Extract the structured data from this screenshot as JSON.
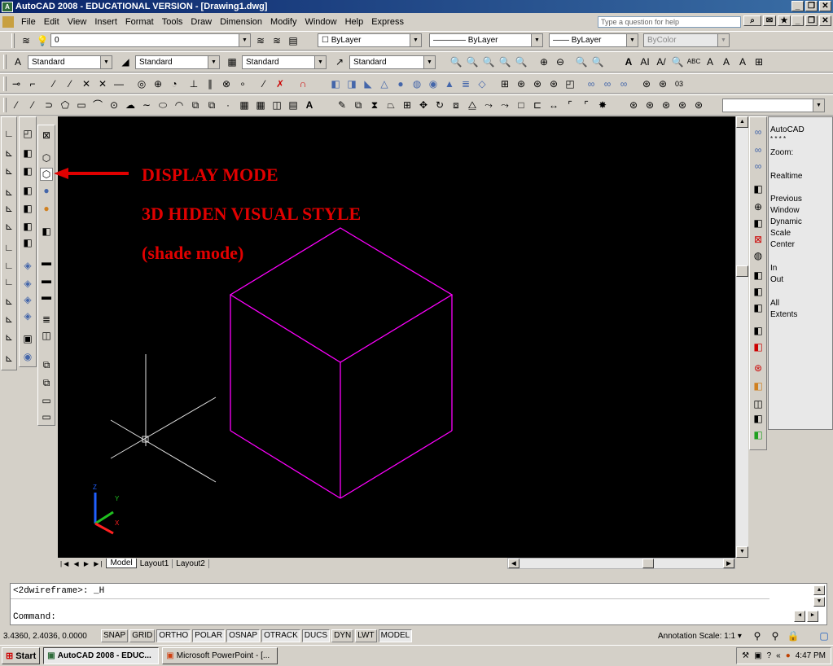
{
  "window": {
    "title": "AutoCAD 2008 - EDUCATIONAL VERSION - [Drawing1.dwg]"
  },
  "menu": [
    "File",
    "Edit",
    "View",
    "Insert",
    "Format",
    "Tools",
    "Draw",
    "Dimension",
    "Modify",
    "Window",
    "Help",
    "Express"
  ],
  "help": {
    "placeholder": "Type a question for help"
  },
  "layers": {
    "layer_value": "0",
    "color_value": "ByLayer",
    "linetype_value": "ByLayer",
    "lineweight_value": "ByLayer",
    "plotstyle_value": "ByColor"
  },
  "styles": {
    "text_style": "Standard",
    "dim_style": "Standard",
    "table_style": "Standard",
    "mleader_style": "Standard"
  },
  "annotation": {
    "line1": "DISPLAY MODE",
    "line2": "3D HIDEN VISUAL STYLE",
    "line3": "(shade mode)"
  },
  "right_panel": [
    "AutoCAD",
    "* * * *",
    "Zoom:",
    "Realtime",
    "Previous",
    "Window",
    "Dynamic",
    "Scale",
    "Center",
    "In",
    "Out",
    "All",
    "Extents"
  ],
  "tabs": [
    "Model",
    "Layout1",
    "Layout2"
  ],
  "command": {
    "history": "<2dwireframe>: _H",
    "prompt": "Command:"
  },
  "status": {
    "coords": "3.4360, 2.4036, 0.0000",
    "toggles": [
      "SNAP",
      "GRID",
      "ORTHO",
      "POLAR",
      "OSNAP",
      "OTRACK",
      "DUCS",
      "DYN",
      "LWT",
      "MODEL"
    ],
    "annotation_scale": "Annotation Scale:  1:1 ▾"
  },
  "taskbar": {
    "start": "Start",
    "app1": "AutoCAD 2008 - EDUC...",
    "app2": "Microsoft PowerPoint - [...",
    "time": "4:47 PM"
  },
  "colors": {
    "cube": "#ff00ff",
    "annotation": "#e00000",
    "canvas": "#000000"
  }
}
